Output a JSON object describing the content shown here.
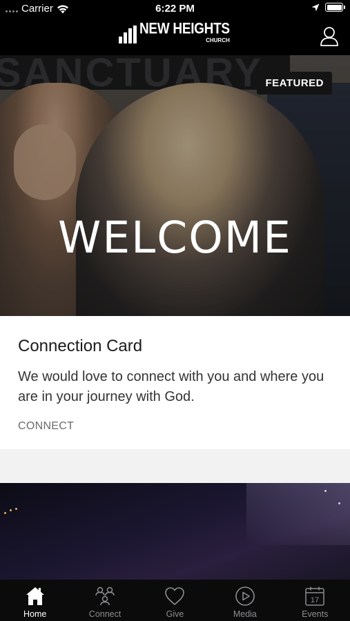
{
  "status_bar": {
    "carrier": "Carrier",
    "time": "6:22 PM"
  },
  "header": {
    "logo_main": "NEW HEIGHTS",
    "logo_sub": "CHURCH",
    "profile_icon": "user-profile-icon"
  },
  "hero": {
    "sign_text": "SANCTUARY",
    "title": "WELCOME",
    "badge": "FEATURED"
  },
  "card": {
    "title": "Connection Card",
    "body": "We would love to connect with you and where you are in your journey with God.",
    "action": "CONNECT"
  },
  "tabs": [
    {
      "label": "Home",
      "icon": "home-icon",
      "active": true
    },
    {
      "label": "Connect",
      "icon": "people-icon",
      "active": false
    },
    {
      "label": "Give",
      "icon": "heart-icon",
      "active": false
    },
    {
      "label": "Media",
      "icon": "play-circle-icon",
      "active": false
    },
    {
      "label": "Events",
      "icon": "calendar-icon",
      "active": false
    }
  ],
  "calendar_day": "17",
  "colors": {
    "background": "#000000",
    "tab_active": "#ffffff",
    "tab_inactive": "#8e8e93",
    "card_bg": "#ffffff"
  }
}
